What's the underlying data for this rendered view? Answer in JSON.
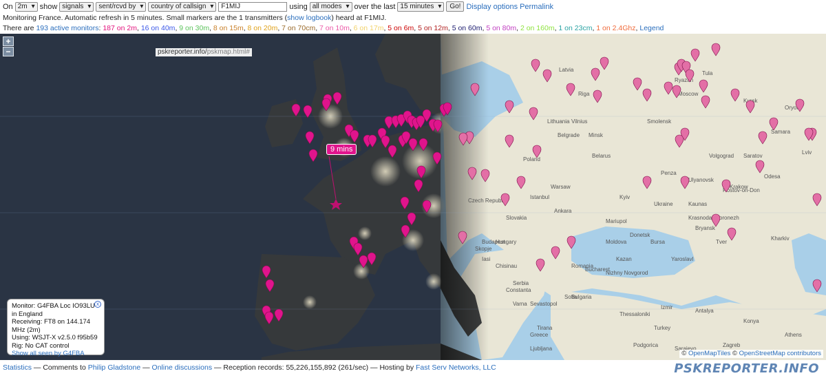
{
  "controls": {
    "on_label": "On",
    "band_value": "2m",
    "show_label": "show",
    "show_value": "signals",
    "direction_value": "sent/rcvd by",
    "filter_value": "country of callsign",
    "callsign_value": "F1MIJ",
    "using_label": "using",
    "modes_value": "all modes",
    "over_label": "over the last",
    "period_value": "15 minutes",
    "go_label": "Go!",
    "display_options_label": "Display options",
    "permalink_label": "Permalink"
  },
  "info": {
    "line1_a": "Monitoring France. Automatic refresh in 5 minutes. Small markers are the 1 transmitters (",
    "logbook_link": "show logbook",
    "line1_b": ") heard at F1MIJ.",
    "there_are": "There are",
    "active_monitors": "193 active monitors",
    "legend_link": "Legend",
    "bands": [
      {
        "text": "187 on 2m",
        "color": "#e3127d"
      },
      {
        "text": "16 on 40m",
        "color": "#3a57e8"
      },
      {
        "text": "9 on 30m",
        "color": "#5cc35c"
      },
      {
        "text": "8 on 15m",
        "color": "#c9802a"
      },
      {
        "text": "8 on 20m",
        "color": "#e0a21b"
      },
      {
        "text": "7 on 70cm",
        "color": "#9a6a2a"
      },
      {
        "text": "7 on 10m",
        "color": "#ec5aa8"
      },
      {
        "text": "6 on 17m",
        "color": "#f2d36b"
      },
      {
        "text": "5 on 6m",
        "color": "#cc0000"
      },
      {
        "text": "5 on 12m",
        "color": "#b22222"
      },
      {
        "text": "5 on 60m",
        "color": "#1a1a6e"
      },
      {
        "text": "5 on 80m",
        "color": "#c13fc1"
      },
      {
        "text": "2 on 160m",
        "color": "#8fe33f"
      },
      {
        "text": "1 on 23cm",
        "color": "#2aa3a3"
      },
      {
        "text": "1 on 2.4Ghz",
        "color": "#f06a3a"
      }
    ]
  },
  "map": {
    "url_chip_main": "pskreporter.info/",
    "url_chip_dim": "pskmap.html#",
    "zoom_in": "+",
    "zoom_out": "−",
    "marker_label": "9 mins",
    "marker_color": "#e0148c",
    "attribution_tiles": "OpenMapTiles",
    "attribution_osm": "OpenStreetMap contributors",
    "copyright": "©",
    "place_labels": [
      "Latvia",
      "Lithuania",
      "Belarus",
      "Poland",
      "Ukraine",
      "Czech Republic",
      "Slovakia",
      "Hungary",
      "Romania",
      "Moldova",
      "Bulgaria",
      "Serbia",
      "Greece",
      "Turkey",
      "Moscow",
      "Smolensk",
      "Minsk",
      "Kyiv",
      "Warsaw",
      "Vilnius",
      "Riga",
      "Budapest",
      "Bucharest",
      "Sofia",
      "Belgrade",
      "Istanbul",
      "Ankara",
      "Bursa",
      "Kaunas",
      "Krakow",
      "Lviv",
      "Odesa",
      "Kharkiv",
      "Voronezh",
      "Samara",
      "Saratov",
      "Volgograd",
      "Rostov-on-Don",
      "Krasnodar",
      "Ulyanovsk",
      "Penza",
      "Ryazan",
      "Tula",
      "Kursk",
      "Oryol",
      "Bryansk",
      "Tver",
      "Yaroslavl",
      "Nizhny Novgorod",
      "Kazan",
      "Donetsk",
      "Mariupol",
      "Sevastopol",
      "Varna",
      "Constanta",
      "Chisinau",
      "Iasi",
      "Skopje",
      "Tirana",
      "Podgorica",
      "Sarajevo",
      "Zagreb",
      "Ljubljana",
      "Thessaloniki",
      "Izmir",
      "Antalya",
      "Konya",
      "Athens"
    ]
  },
  "popup": {
    "line1": "Monitor: G4FBA Loc IO93LU",
    "line2": "in England",
    "line3": "Receiving: FT8 on 144.174 MHz (2m)",
    "line4": "Using: WSJT-X v2.5.0 f95b59",
    "line5": "Rig: No CAT control",
    "link": "Show all seen by G4FBA",
    "close_label": "x"
  },
  "footer": {
    "statistics": "Statistics",
    "sep1": " — Comments to ",
    "author": "Philip Gladstone",
    "sep2": " — ",
    "discussions": "Online discussions",
    "records": " — Reception records: 55,226,155,892 (261/sec) — Hosting by ",
    "hosting": "Fast Serv Networks, LLC",
    "brand": "PSKREPORTER.INFO"
  }
}
